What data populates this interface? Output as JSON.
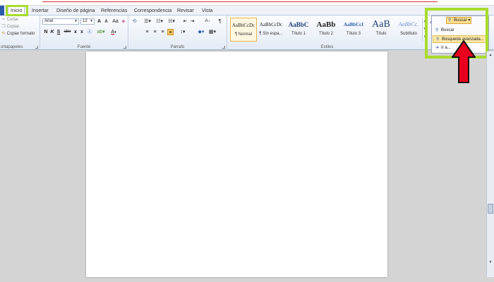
{
  "tabs": [
    "Inicio",
    "Insertar",
    "Diseño de página",
    "Referencias",
    "Correspondencia",
    "Revisar",
    "Vista"
  ],
  "clipboard": {
    "cut": "Cortar",
    "copy": "Copiar",
    "format_painter": "Copiar formato",
    "label": "ortapapeles"
  },
  "font": {
    "name": "Arial",
    "size": "12",
    "grow": "A",
    "shrink": "A",
    "case": "Aa",
    "bold": "N",
    "italic": "K",
    "underline": "S",
    "strike": "abe",
    "subscript": "x",
    "superscript": "x",
    "color_a": "A",
    "label": "Fuente"
  },
  "paragraph": {
    "sort": "A↓",
    "pilcrow": "¶",
    "label": "Párrafo"
  },
  "styles": {
    "items": [
      {
        "sample": "AaBbCcDc",
        "name": "¶ Normal"
      },
      {
        "sample": "AaBbCcDc",
        "name": "¶ Sin espa..."
      },
      {
        "sample": "AaBbC",
        "name": "Título 1"
      },
      {
        "sample": "AaBb",
        "name": "Título 2"
      },
      {
        "sample": "AaBbCcI",
        "name": "Título 3"
      },
      {
        "sample": "AaB",
        "name": "Título"
      },
      {
        "sample": "AaBbCc.",
        "name": "Subtítulo"
      }
    ],
    "label": "Estilos"
  },
  "editing": {
    "change_styles_icon": "AA",
    "find_button": "Buscar",
    "menu": [
      "Buscar",
      "Búsqueda avanzada...",
      "Ir a..."
    ]
  },
  "colors": {
    "highlight": "#a8dc2e",
    "arrow": "#e8001c",
    "accent": "#2a5caa"
  }
}
